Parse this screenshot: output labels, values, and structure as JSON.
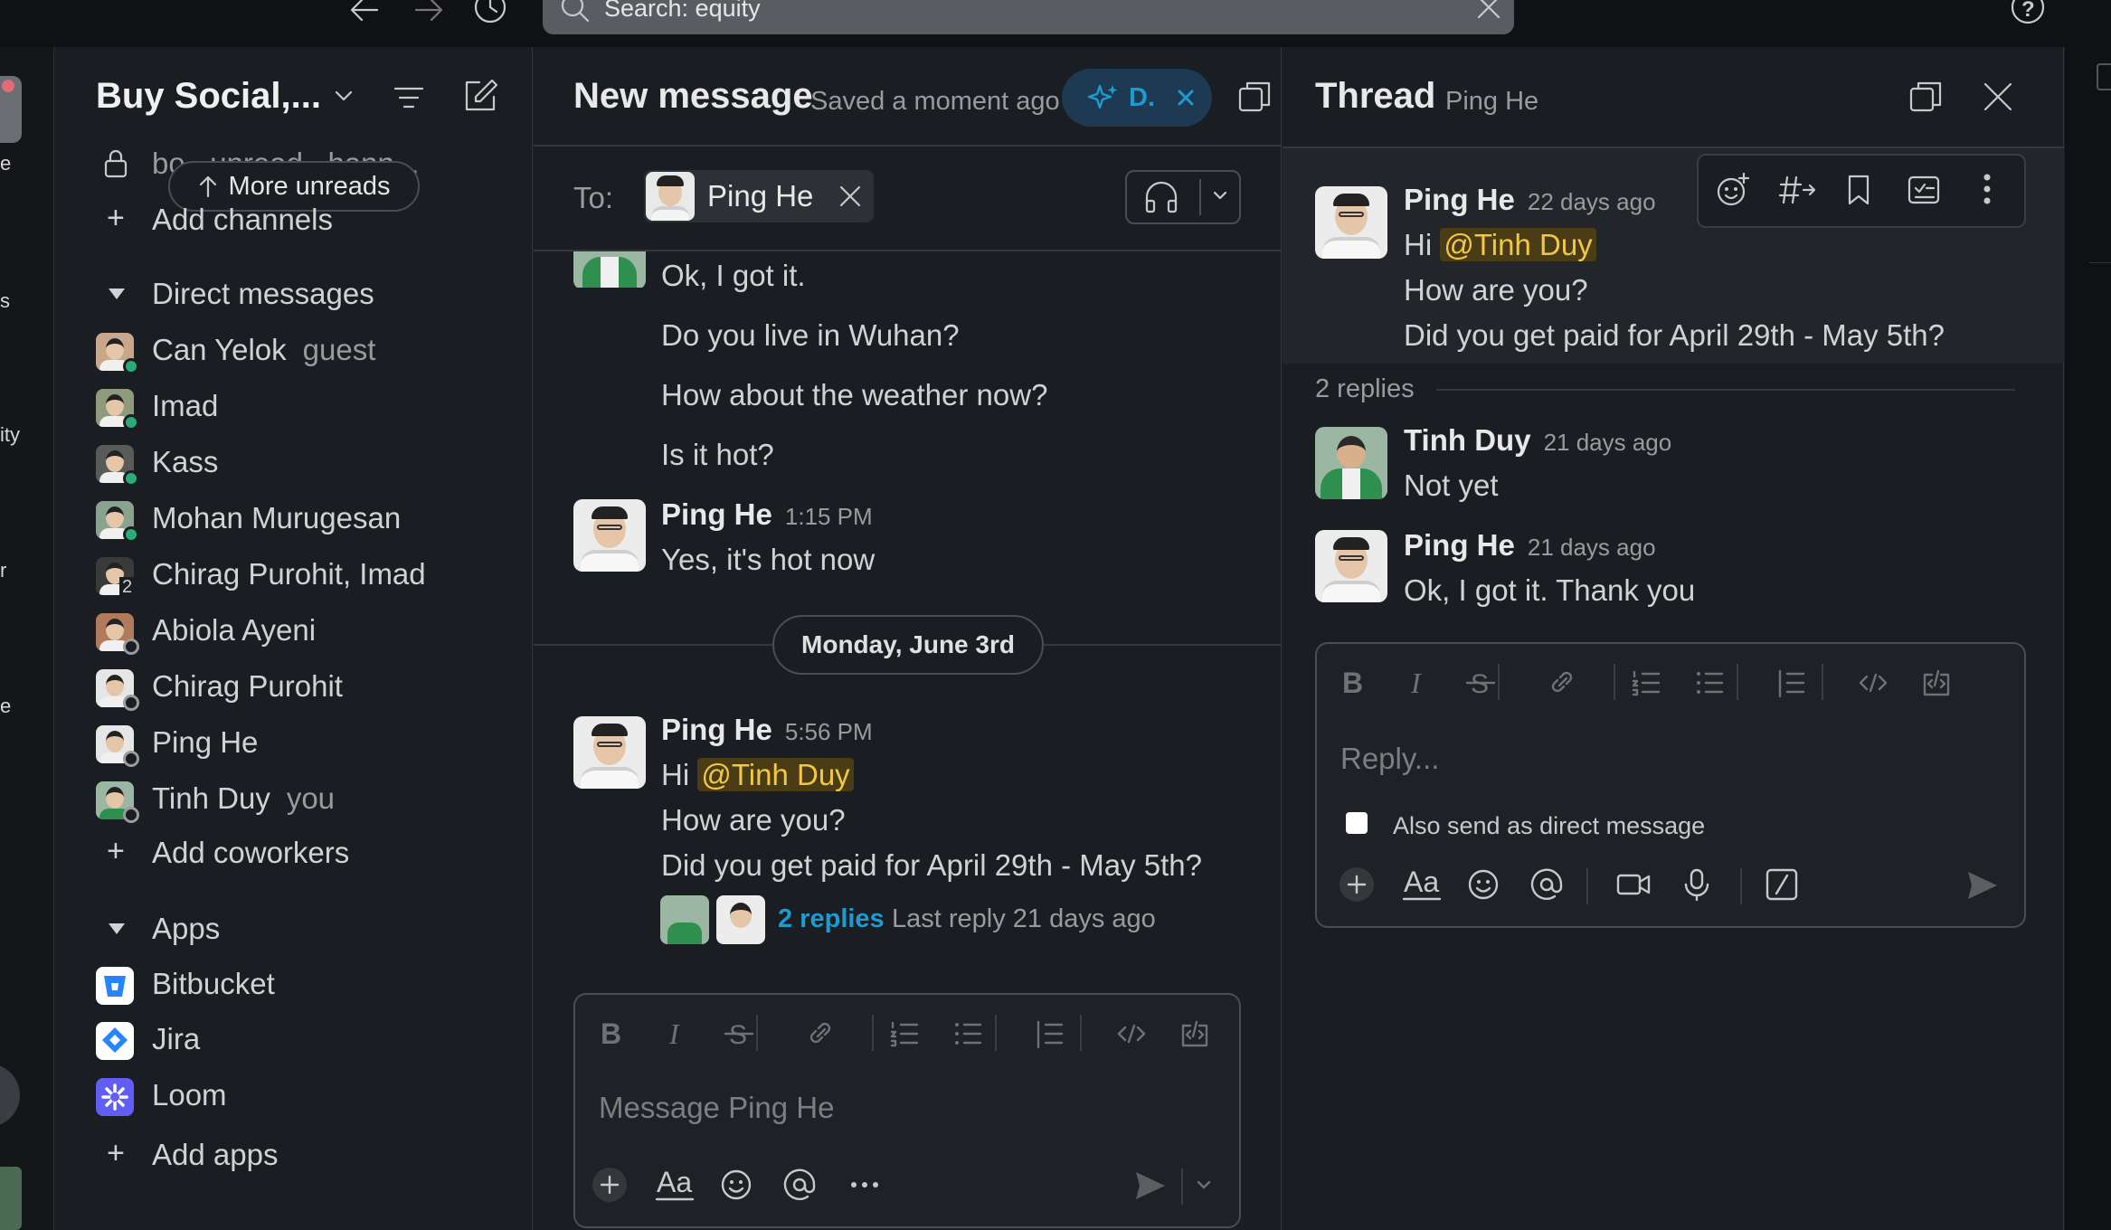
{
  "topbar": {
    "search_text": "Search: equity"
  },
  "rail": {
    "frag1": "e",
    "frag2": "s",
    "frag3": "ity",
    "frag4": "r",
    "frag5": "e"
  },
  "sidebar": {
    "workspace": "Buy Social,...",
    "channel_partial": "bo...unread...hann...",
    "more_unreads": "More unreads",
    "add_channels": "Add channels",
    "dm_section": "Direct messages",
    "dms": [
      {
        "name": "Can Yelok",
        "sub": "guest"
      },
      {
        "name": "Imad",
        "sub": ""
      },
      {
        "name": "Kass",
        "sub": ""
      },
      {
        "name": "Mohan Murugesan",
        "sub": ""
      },
      {
        "name": "Chirag Purohit, Imad",
        "sub": "",
        "badge": "2"
      },
      {
        "name": "Abiola Ayeni",
        "sub": ""
      },
      {
        "name": "Chirag Purohit",
        "sub": ""
      },
      {
        "name": "Ping He",
        "sub": ""
      },
      {
        "name": "Tinh Duy",
        "sub": "you"
      }
    ],
    "add_coworkers": "Add coworkers",
    "apps_section": "Apps",
    "apps": [
      {
        "name": "Bitbucket",
        "color": "#2684ff"
      },
      {
        "name": "Jira",
        "color": "#2684ff"
      },
      {
        "name": "Loom",
        "color": "#625df5"
      }
    ],
    "add_apps": "Add apps"
  },
  "main": {
    "title": "New message",
    "saved": "Saved a moment ago",
    "draft_chip": "D.",
    "to_label": "To:",
    "recipient": "Ping He",
    "messages": [
      {
        "text": "Ok, I got it."
      },
      {
        "text": "Do you live in Wuhan?"
      },
      {
        "text": "How about the weather now?"
      },
      {
        "text": "Is it hot?"
      }
    ],
    "msg2": {
      "name": "Ping He",
      "time": "1:15 PM",
      "text": "Yes, it's hot now"
    },
    "date_divider": "Monday, June 3rd",
    "msg3": {
      "name": "Ping He",
      "time": "5:56 PM",
      "hi": "Hi",
      "mention": "@Tinh Duy",
      "line2": "How are you?",
      "line3": "Did you get paid for April 29th - May 5th?",
      "replies": "2 replies",
      "last_reply": "Last reply 21 days ago"
    },
    "composer_placeholder": "Message Ping He"
  },
  "thread": {
    "title": "Thread",
    "subtitle": "Ping He",
    "root": {
      "name": "Ping He",
      "time": "22 days ago",
      "hi": "Hi",
      "mention": "@Tinh Duy",
      "line2": "How are you?",
      "line3": "Did you get paid for April 29th - May 5th?"
    },
    "replies_count": "2 replies",
    "reply1": {
      "name": "Tinh Duy",
      "time": "21 days ago",
      "text": "Not yet"
    },
    "reply2": {
      "name": "Ping He",
      "time": "21 days ago",
      "text": "Ok, I got it. Thank you"
    },
    "reply_placeholder": "Reply...",
    "also_send": "Also send as direct message"
  },
  "colors": {
    "accent_blue": "#1d9bd1",
    "mention_bg": "#4a3c15",
    "mention_fg": "#f2c744",
    "online": "#2bac76"
  }
}
